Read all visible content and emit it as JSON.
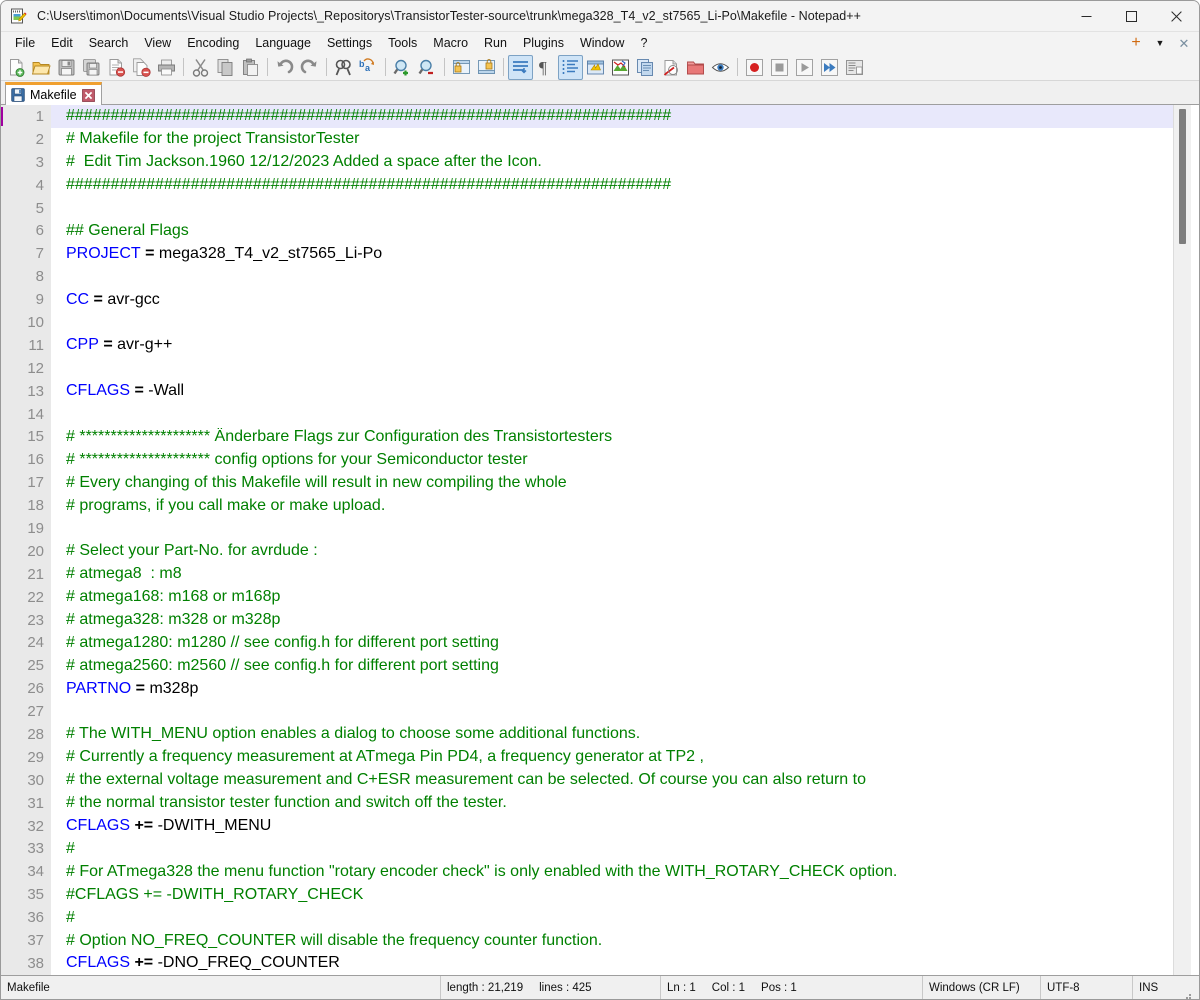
{
  "window": {
    "title": "C:\\Users\\timon\\Documents\\Visual Studio Projects\\_Repositorys\\TransistorTester-source\\trunk\\mega328_T4_v2_st7565_Li-Po\\Makefile - Notepad++",
    "app_icon": "notepad-plus-plus-icon",
    "minimize_label": "—",
    "maximize_label": "☐",
    "close_label": "✕"
  },
  "menubar": {
    "items": [
      {
        "label": "File"
      },
      {
        "label": "Edit"
      },
      {
        "label": "Search"
      },
      {
        "label": "View"
      },
      {
        "label": "Encoding"
      },
      {
        "label": "Language"
      },
      {
        "label": "Settings"
      },
      {
        "label": "Tools"
      },
      {
        "label": "Macro"
      },
      {
        "label": "Run"
      },
      {
        "label": "Plugins"
      },
      {
        "label": "Window"
      },
      {
        "label": "?"
      }
    ],
    "right": {
      "new_tab": "+",
      "tab_list": "▼",
      "close_doc": "✕"
    }
  },
  "toolbar": {
    "buttons": [
      {
        "name": "new-file-icon",
        "tip": "New"
      },
      {
        "name": "open-file-icon",
        "tip": "Open"
      },
      {
        "name": "save-icon",
        "tip": "Save"
      },
      {
        "name": "save-all-icon",
        "tip": "Save All"
      },
      {
        "name": "close-document-icon",
        "tip": "Close"
      },
      {
        "name": "close-all-documents-icon",
        "tip": "Close All"
      },
      {
        "name": "print-icon",
        "tip": "Print"
      },
      {
        "name": "separator-1",
        "tip": ""
      },
      {
        "name": "cut-icon",
        "tip": "Cut"
      },
      {
        "name": "copy-icon",
        "tip": "Copy"
      },
      {
        "name": "paste-icon",
        "tip": "Paste"
      },
      {
        "name": "separator-2",
        "tip": ""
      },
      {
        "name": "undo-icon",
        "tip": "Undo"
      },
      {
        "name": "redo-icon",
        "tip": "Redo"
      },
      {
        "name": "separator-3",
        "tip": ""
      },
      {
        "name": "find-icon",
        "tip": "Find"
      },
      {
        "name": "replace-icon",
        "tip": "Replace"
      },
      {
        "name": "separator-4",
        "tip": ""
      },
      {
        "name": "zoom-in-icon",
        "tip": "Zoom In"
      },
      {
        "name": "zoom-out-icon",
        "tip": "Zoom Out"
      },
      {
        "name": "separator-5",
        "tip": ""
      },
      {
        "name": "sync-vertical-scroll-icon",
        "tip": "Synchronize Vertical Scrolling"
      },
      {
        "name": "sync-horizontal-scroll-icon",
        "tip": "Synchronize Horizontal Scrolling"
      },
      {
        "name": "separator-6",
        "tip": ""
      },
      {
        "name": "word-wrap-icon",
        "tip": "Word wrap"
      },
      {
        "name": "show-all-characters-icon",
        "tip": "Show All Characters"
      },
      {
        "name": "show-indent-guide-icon",
        "tip": "Show Indent Guide"
      },
      {
        "name": "show-ui-icon",
        "tip": "Show UI"
      },
      {
        "name": "user-defined-language-icon",
        "tip": "User-Defined Dialogue"
      },
      {
        "name": "document-map-icon",
        "tip": "Document Map"
      },
      {
        "name": "function-list-icon",
        "tip": "Function List"
      },
      {
        "name": "folder-as-workspace-icon",
        "tip": "Folder as Workspace"
      },
      {
        "name": "monitoring-icon",
        "tip": "Monitoring"
      },
      {
        "name": "separator-7",
        "tip": ""
      },
      {
        "name": "record-macro-icon",
        "tip": "Start Recording"
      },
      {
        "name": "stop-macro-icon",
        "tip": "Stop Recording"
      },
      {
        "name": "play-macro-icon",
        "tip": "Playback"
      },
      {
        "name": "run-macro-multiple-icon",
        "tip": "Run a Macro Multiple Times"
      },
      {
        "name": "save-macro-icon",
        "tip": "Save Current Recorded Macro"
      }
    ]
  },
  "tabs": [
    {
      "label": "Makefile",
      "icon": "save-floppy-icon",
      "close": "✕",
      "active": true
    }
  ],
  "editor": {
    "first_line": 1,
    "current_line": 1,
    "lines": [
      {
        "n": 1,
        "segments": [
          {
            "cls": "cm",
            "t": "####################################################################"
          }
        ]
      },
      {
        "n": 2,
        "segments": [
          {
            "cls": "cm",
            "t": "# Makefile for the project TransistorTester"
          }
        ]
      },
      {
        "n": 3,
        "segments": [
          {
            "cls": "cm",
            "t": "#  Edit Tim Jackson.1960 12/12/2023 Added a space after the Icon."
          }
        ]
      },
      {
        "n": 4,
        "segments": [
          {
            "cls": "cm",
            "t": "####################################################################"
          }
        ]
      },
      {
        "n": 5,
        "segments": []
      },
      {
        "n": 6,
        "segments": [
          {
            "cls": "cm",
            "t": "## General Flags"
          }
        ]
      },
      {
        "n": 7,
        "segments": [
          {
            "cls": "kw",
            "t": "PROJECT"
          },
          {
            "cls": "op",
            "t": " = "
          },
          {
            "cls": "val",
            "t": "mega328_T4_v2_st7565_Li-Po"
          }
        ]
      },
      {
        "n": 8,
        "segments": []
      },
      {
        "n": 9,
        "segments": [
          {
            "cls": "kw",
            "t": "CC"
          },
          {
            "cls": "op",
            "t": " = "
          },
          {
            "cls": "val",
            "t": "avr-gcc"
          }
        ]
      },
      {
        "n": 10,
        "segments": []
      },
      {
        "n": 11,
        "segments": [
          {
            "cls": "kw",
            "t": "CPP"
          },
          {
            "cls": "op",
            "t": " = "
          },
          {
            "cls": "val",
            "t": "avr-g++"
          }
        ]
      },
      {
        "n": 12,
        "segments": []
      },
      {
        "n": 13,
        "segments": [
          {
            "cls": "kw",
            "t": "CFLAGS"
          },
          {
            "cls": "op",
            "t": " = "
          },
          {
            "cls": "val",
            "t": "-Wall"
          }
        ]
      },
      {
        "n": 14,
        "segments": []
      },
      {
        "n": 15,
        "segments": [
          {
            "cls": "cm",
            "t": "# ********************* Änderbare Flags zur Configuration des Transistortesters"
          }
        ]
      },
      {
        "n": 16,
        "segments": [
          {
            "cls": "cm",
            "t": "# ********************* config options for your Semiconductor tester"
          }
        ]
      },
      {
        "n": 17,
        "segments": [
          {
            "cls": "cm",
            "t": "# Every changing of this Makefile will result in new compiling the whole"
          }
        ]
      },
      {
        "n": 18,
        "segments": [
          {
            "cls": "cm",
            "t": "# programs, if you call make or make upload."
          }
        ]
      },
      {
        "n": 19,
        "segments": []
      },
      {
        "n": 20,
        "segments": [
          {
            "cls": "cm",
            "t": "# Select your Part-No. for avrdude :"
          }
        ]
      },
      {
        "n": 21,
        "segments": [
          {
            "cls": "cm",
            "t": "# atmega8  : m8"
          }
        ]
      },
      {
        "n": 22,
        "segments": [
          {
            "cls": "cm",
            "t": "# atmega168: m168 or m168p"
          }
        ]
      },
      {
        "n": 23,
        "segments": [
          {
            "cls": "cm",
            "t": "# atmega328: m328 or m328p"
          }
        ]
      },
      {
        "n": 24,
        "segments": [
          {
            "cls": "cm",
            "t": "# atmega1280: m1280 // see config.h for different port setting"
          }
        ]
      },
      {
        "n": 25,
        "segments": [
          {
            "cls": "cm",
            "t": "# atmega2560: m2560 // see config.h for different port setting"
          }
        ]
      },
      {
        "n": 26,
        "segments": [
          {
            "cls": "kw",
            "t": "PARTNO"
          },
          {
            "cls": "op",
            "t": " = "
          },
          {
            "cls": "val",
            "t": "m328p"
          }
        ]
      },
      {
        "n": 27,
        "segments": []
      },
      {
        "n": 28,
        "segments": [
          {
            "cls": "cm",
            "t": "# The WITH_MENU option enables a dialog to choose some additional functions."
          }
        ]
      },
      {
        "n": 29,
        "segments": [
          {
            "cls": "cm",
            "t": "# Currently a frequency measurement at ATmega Pin PD4, a frequency generator at TP2 ,"
          }
        ]
      },
      {
        "n": 30,
        "segments": [
          {
            "cls": "cm",
            "t": "# the external voltage measurement and C+ESR measurement can be selected. Of course you can also return to"
          }
        ]
      },
      {
        "n": 31,
        "segments": [
          {
            "cls": "cm",
            "t": "# the normal transistor tester function and switch off the tester."
          }
        ]
      },
      {
        "n": 32,
        "segments": [
          {
            "cls": "kw",
            "t": "CFLAGS"
          },
          {
            "cls": "op",
            "t": " += "
          },
          {
            "cls": "val",
            "t": "-DWITH_MENU"
          }
        ]
      },
      {
        "n": 33,
        "segments": [
          {
            "cls": "cm",
            "t": "#"
          }
        ]
      },
      {
        "n": 34,
        "segments": [
          {
            "cls": "cm",
            "t": "# For ATmega328 the menu function \"rotary encoder check\" is only enabled with the WITH_ROTARY_CHECK option."
          }
        ]
      },
      {
        "n": 35,
        "segments": [
          {
            "cls": "cm",
            "t": "#CFLAGS += -DWITH_ROTARY_CHECK"
          }
        ]
      },
      {
        "n": 36,
        "segments": [
          {
            "cls": "cm",
            "t": "#"
          }
        ]
      },
      {
        "n": 37,
        "segments": [
          {
            "cls": "cm",
            "t": "# Option NO_FREQ_COUNTER will disable the frequency counter function."
          }
        ]
      },
      {
        "n": 38,
        "segments": [
          {
            "cls": "kw",
            "t": "CFLAGS"
          },
          {
            "cls": "op",
            "t": " += "
          },
          {
            "cls": "val",
            "t": "-DNO_FREQ_COUNTER"
          }
        ]
      }
    ]
  },
  "statusbar": {
    "doc_type": "Makefile",
    "length_label": "length : 21,219",
    "lines_label": "lines : 425",
    "ln": "Ln : 1",
    "col": "Col : 1",
    "pos": "Pos : 1",
    "eol": "Windows (CR LF)",
    "encoding": "UTF-8",
    "insert_mode": "INS"
  },
  "colors": {
    "comment_green": "#008000",
    "keyword_blue": "#0000ff",
    "current_line_bg": "#e8e8fb",
    "tab_accent": "#f0a030",
    "gutter_bg": "#e9e9e9"
  }
}
